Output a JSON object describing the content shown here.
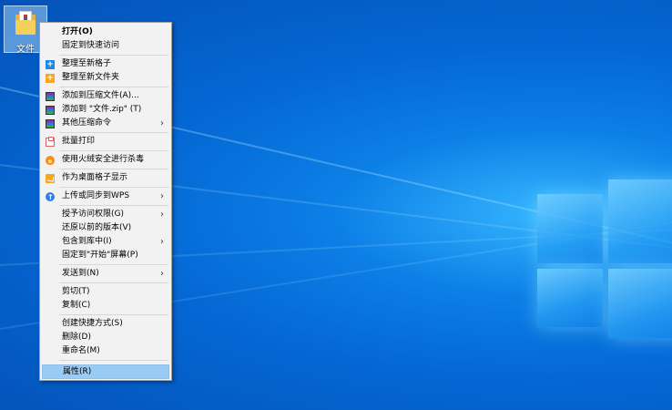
{
  "desktop": {
    "icon": {
      "name": "folder-zip-icon",
      "label": "文件"
    },
    "wallpaper_colors": {
      "base": "#0467d4",
      "glow": "#36b6ff"
    }
  },
  "context_menu": {
    "hover_color": "#99cbf5",
    "items": [
      {
        "label": "打开(O)",
        "bold": true
      },
      {
        "label": "固定到快速访问"
      },
      {
        "label": "整理至新格子",
        "icon": "plus-blue-icon"
      },
      {
        "label": "整理至新文件夹",
        "icon": "plus-orange-icon"
      },
      {
        "label": "添加到压缩文件(A)...",
        "icon": "winrar-icon"
      },
      {
        "label": "添加到 \"文件.zip\" (T)",
        "icon": "winrar-icon"
      },
      {
        "label": "其他压缩命令",
        "icon": "winrar-icon",
        "submenu": true
      },
      {
        "label": "批量打印",
        "icon": "printer-icon"
      },
      {
        "label": "使用火绒安全进行杀毒",
        "icon": "huorong-fire-icon"
      },
      {
        "label": "作为桌面格子显示",
        "icon": "desktop-folder-icon"
      },
      {
        "label": "上传或同步到WPS",
        "icon": "cloud-upload-icon",
        "submenu": true
      },
      {
        "label": "授予访问权限(G)",
        "submenu": true
      },
      {
        "label": "还原以前的版本(V)"
      },
      {
        "label": "包含到库中(I)",
        "submenu": true
      },
      {
        "label": "固定到\"开始\"屏幕(P)"
      },
      {
        "label": "发送到(N)",
        "submenu": true
      },
      {
        "label": "剪切(T)"
      },
      {
        "label": "复制(C)"
      },
      {
        "label": "创建快捷方式(S)"
      },
      {
        "label": "删除(D)"
      },
      {
        "label": "重命名(M)"
      },
      {
        "label": "属性(R)",
        "hovered": true
      }
    ],
    "submenu_arrow": "›"
  }
}
